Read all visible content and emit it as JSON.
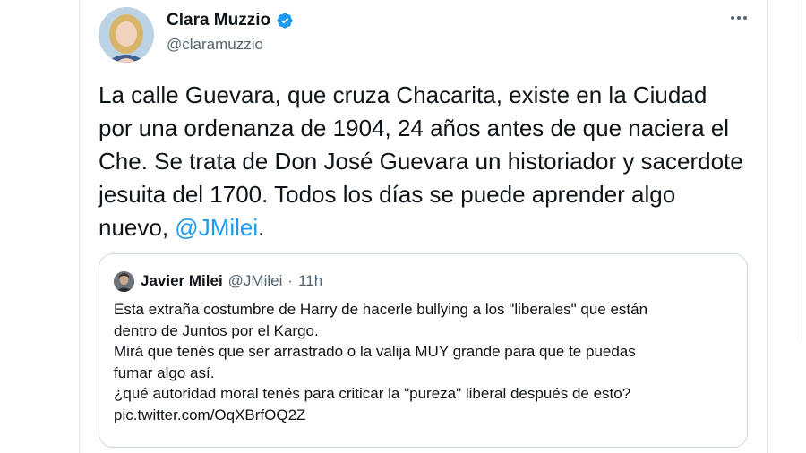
{
  "tweet": {
    "author_name": "Clara Muzzio",
    "author_handle": "@claramuzzio",
    "text_before": "La calle Guevara, que cruza Chacarita, existe en la Ciudad por una ordenanza de 1904, 24 años antes de que naciera el Che. Se trata de Don José Guevara un historiador y sacerdote jesuita del 1700. Todos los días se puede aprender algo nuevo, ",
    "mention": "@JMilei",
    "text_after": ".",
    "more_icon": "more-options-icon",
    "verified_icon": "verified-badge-icon"
  },
  "quoted": {
    "author_name": "Javier Milei",
    "author_handle": "@JMilei",
    "separator": "·",
    "time": "11h",
    "lines": [
      "Esta extraña costumbre de Harry de hacerle bullying a los \"liberales\" que están",
      "dentro de Juntos por el Kargo.",
      "Mirá que tenés que ser arrastrado o la valija MUY grande para que te puedas",
      "fumar algo así.",
      "¿qué autoridad moral tenés para criticar la \"pureza\" liberal después de esto?",
      "pic.twitter.com/OqXBrfOQ2Z"
    ]
  },
  "colors": {
    "accent": "#1d9bf0",
    "text": "#0f1419",
    "muted": "#536471",
    "border": "#cfd9de"
  }
}
